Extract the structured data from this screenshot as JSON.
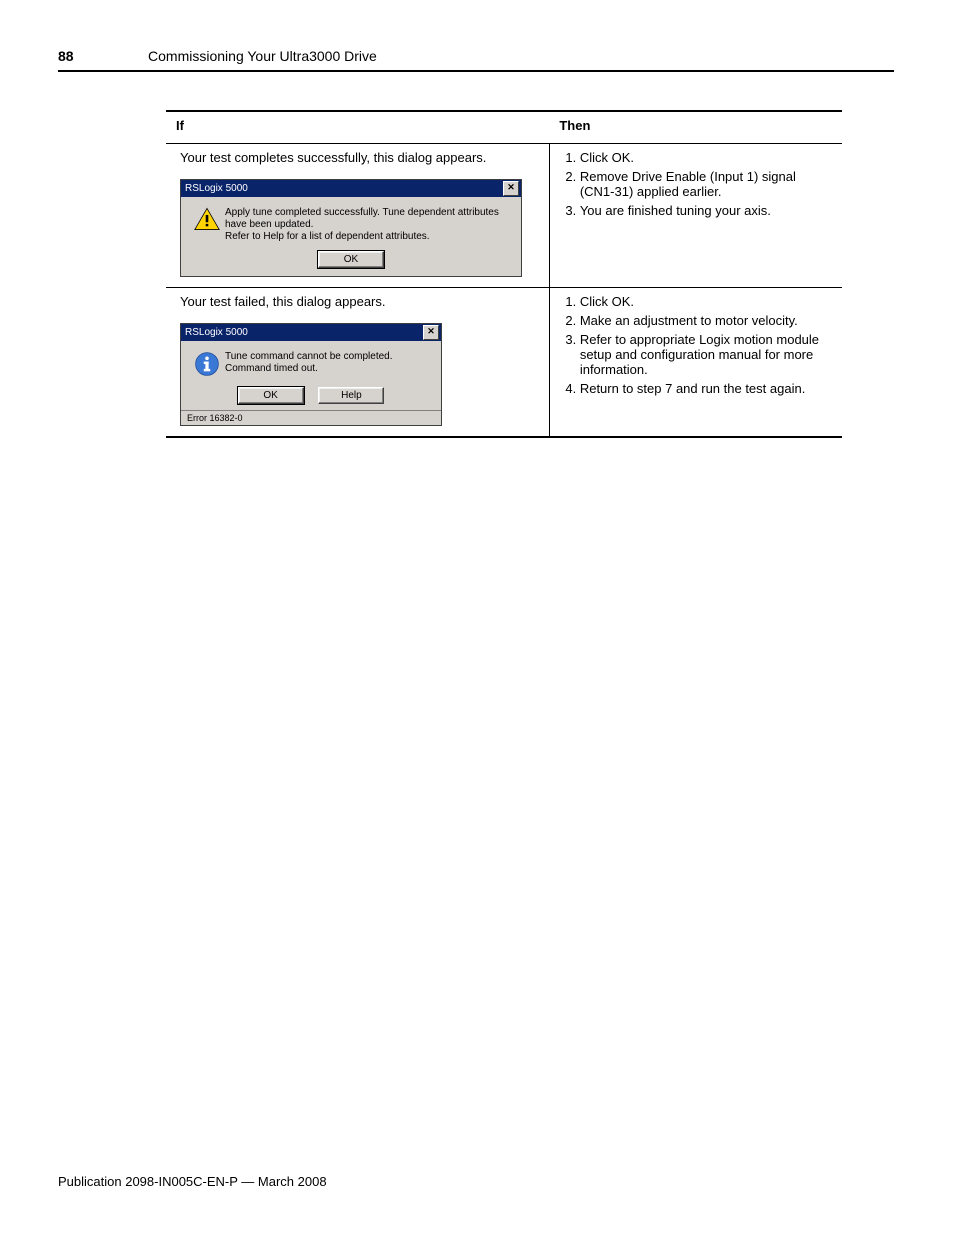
{
  "page": {
    "number": "88",
    "chapter_title": "Commissioning Your Ultra3000 Drive",
    "publication_line": "Publication 2098-IN005C-EN-P — March 2008"
  },
  "table": {
    "headers": {
      "if": "If",
      "then": "Then"
    },
    "rows": [
      {
        "if_intro": "Your test completes successfully, this dialog appears.",
        "dialog": {
          "title": "RSLogix 5000",
          "close_glyph": "✕",
          "icon": "warning",
          "message_line1": "Apply tune completed successfully. Tune dependent attributes have been updated.",
          "message_line2": "Refer to Help for a list of dependent attributes.",
          "buttons": {
            "ok": "OK"
          }
        },
        "then_steps": [
          "Click OK.",
          "Remove Drive Enable (Input 1) signal (CN1-31) applied earlier.",
          "You are finished tuning your axis."
        ]
      },
      {
        "if_intro": "Your test failed, this dialog appears.",
        "dialog": {
          "title": "RSLogix 5000",
          "close_glyph": "✕",
          "icon": "info",
          "message_line1": "Tune command cannot be completed.",
          "message_line2": "Command timed out.",
          "buttons": {
            "ok": "OK",
            "help": "Help"
          },
          "status": "Error 16382-0"
        },
        "then_steps": [
          "Click OK.",
          "Make an adjustment to motor velocity.",
          "Refer to appropriate Logix motion module setup and configuration manual for more information.",
          "Return to step 7 and run the test again."
        ]
      }
    ]
  }
}
